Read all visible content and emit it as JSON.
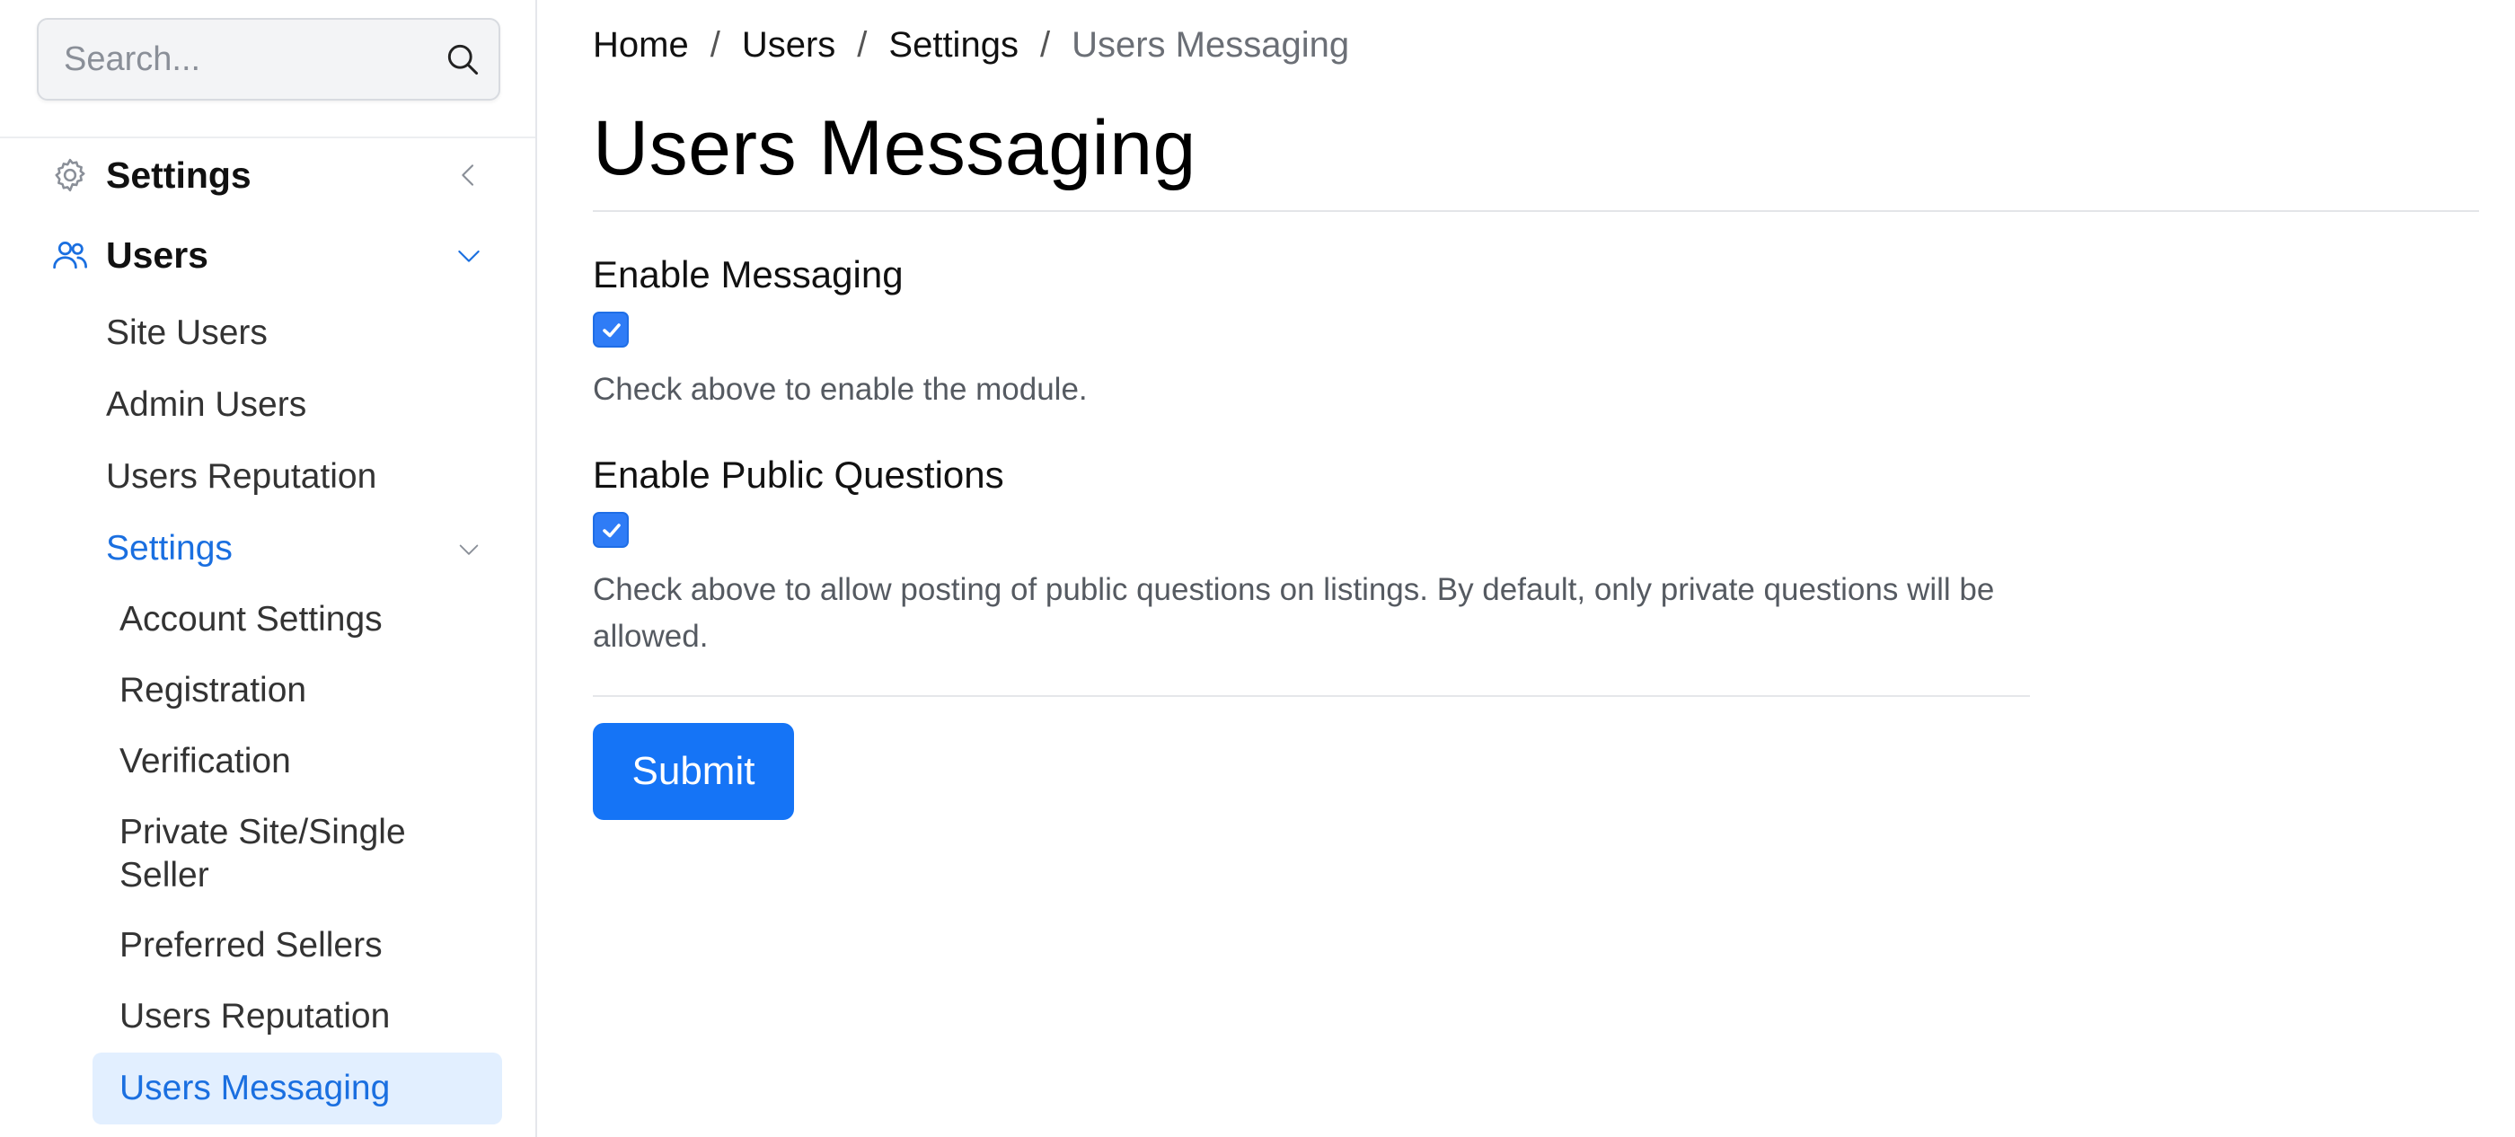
{
  "search": {
    "placeholder": "Search..."
  },
  "sidebar": {
    "top_items": [
      {
        "label": "Settings",
        "icon": "gear-icon",
        "state": "collapsed"
      },
      {
        "label": "Users",
        "icon": "users-icon",
        "state": "expanded"
      }
    ],
    "users_children": [
      "Site Users",
      "Admin Users",
      "Users Reputation",
      "Settings"
    ],
    "settings_children": [
      "Account Settings",
      "Registration",
      "Verification",
      "Private Site/Single Seller",
      "Preferred Sellers",
      "Users Reputation",
      "Users Messaging"
    ],
    "active_item": "Users Messaging"
  },
  "breadcrumb": {
    "items": [
      "Home",
      "Users",
      "Settings",
      "Users Messaging"
    ],
    "separator": "/"
  },
  "page": {
    "title": "Users Messaging"
  },
  "form": {
    "fields": [
      {
        "label": "Enable Messaging",
        "checked": true,
        "help": "Check above to enable the module."
      },
      {
        "label": "Enable Public Questions",
        "checked": true,
        "help": "Check above to allow posting of public questions on listings. By default, only private questions will be allowed."
      }
    ],
    "submit_label": "Submit"
  },
  "colors": {
    "accent": "#1574f6",
    "active_bg": "#e2efff",
    "active_text": "#1a6fe0"
  }
}
